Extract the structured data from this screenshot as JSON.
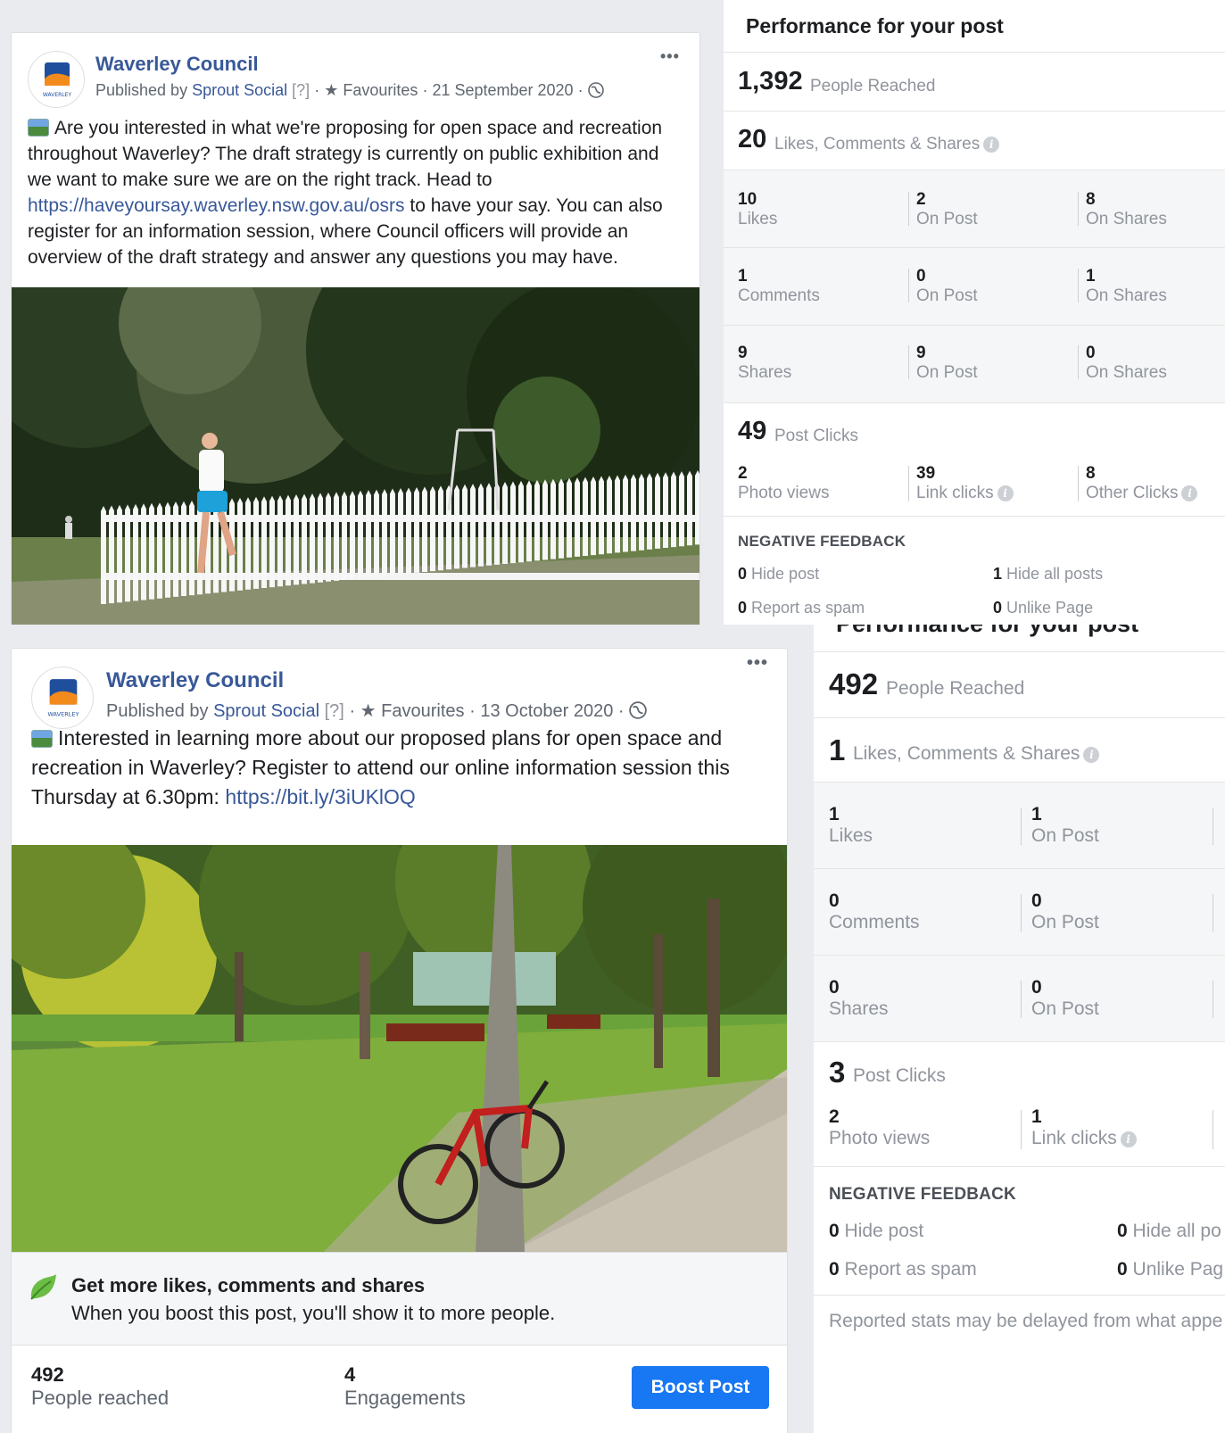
{
  "post1": {
    "page_name": "Waverley Council",
    "published_by_prefix": "Published by",
    "publisher": "Sprout Social",
    "help_marker": "[?]",
    "separator": "·",
    "favourites": "Favourites",
    "date": "21 September 2020",
    "more": "•••",
    "avatar_text": "WAVERLEY",
    "text_before_link": "Are you interested in what we're proposing for open space and recreation throughout Waverley? The draft strategy is currently on public exhibition and we want to make sure we are on the right track. Head to",
    "link": "https://haveyoursay.waverley.nsw.gov.au/osrs",
    "text_after_link": "to have your say. You can also register for an information session, where Council officers will provide an overview of the draft strategy and answer any questions you may have."
  },
  "perf1": {
    "title": "Performance for your post",
    "reached_num": "1,392",
    "reached_label": "People Reached",
    "engage_num": "20",
    "engage_label": "Likes, Comments & Shares",
    "rows": [
      {
        "a_num": "10",
        "a_lbl": "Likes",
        "b_num": "2",
        "b_lbl": "On Post",
        "c_num": "8",
        "c_lbl": "On Shares"
      },
      {
        "a_num": "1",
        "a_lbl": "Comments",
        "b_num": "0",
        "b_lbl": "On Post",
        "c_num": "1",
        "c_lbl": "On Shares"
      },
      {
        "a_num": "9",
        "a_lbl": "Shares",
        "b_num": "9",
        "b_lbl": "On Post",
        "c_num": "0",
        "c_lbl": "On Shares"
      }
    ],
    "clicks_num": "49",
    "clicks_label": "Post Clicks",
    "clicks": {
      "a_num": "2",
      "a_lbl": "Photo views",
      "b_num": "39",
      "b_lbl": "Link clicks",
      "c_num": "8",
      "c_lbl": "Other Clicks"
    },
    "neg_title": "NEGATIVE FEEDBACK",
    "neg": {
      "hide_post_num": "0",
      "hide_post_lbl": "Hide post",
      "hide_all_num": "1",
      "hide_all_lbl": "Hide all posts",
      "spam_num": "0",
      "spam_lbl": "Report as spam",
      "unlike_num": "0",
      "unlike_lbl": "Unlike Page"
    }
  },
  "post2": {
    "page_name": "Waverley Council",
    "published_by_prefix": "Published by",
    "publisher": "Sprout Social",
    "help_marker": "[?]",
    "separator": "·",
    "favourites": "Favourites",
    "date": "13 October 2020",
    "more": "•••",
    "avatar_text": "WAVERLEY",
    "text_before_link": "Interested in learning more about our proposed plans for open space and recreation in Waverley? Register to attend our online information session this Thursday at 6.30pm:",
    "link": "https://bit.ly/3iUKlOQ",
    "boost_title": "Get more likes, comments and shares",
    "boost_sub": "When you boost this post, you'll show it to more people.",
    "reached_num": "492",
    "reached_lbl": "People reached",
    "engage_num": "4",
    "engage_lbl": "Engagements",
    "boost_button": "Boost Post"
  },
  "perf2": {
    "title": "Performance for your post",
    "reached_num": "492",
    "reached_label": "People Reached",
    "engage_num": "1",
    "engage_label": "Likes, Comments & Shares",
    "rows": [
      {
        "a_num": "1",
        "a_lbl": "Likes",
        "b_num": "1",
        "b_lbl": "On Post"
      },
      {
        "a_num": "0",
        "a_lbl": "Comments",
        "b_num": "0",
        "b_lbl": "On Post"
      },
      {
        "a_num": "0",
        "a_lbl": "Shares",
        "b_num": "0",
        "b_lbl": "On Post"
      }
    ],
    "clicks_num": "3",
    "clicks_label": "Post Clicks",
    "clicks": {
      "a_num": "2",
      "a_lbl": "Photo views",
      "b_num": "1",
      "b_lbl": "Link clicks"
    },
    "neg_title": "NEGATIVE FEEDBACK",
    "neg": {
      "hide_post_num": "0",
      "hide_post_lbl": "Hide post",
      "hide_all_num": "0",
      "hide_all_lbl": "Hide all po",
      "spam_num": "0",
      "spam_lbl": "Report as spam",
      "unlike_num": "0",
      "unlike_lbl": "Unlike Pag"
    },
    "footer": "Reported stats may be delayed from what appe"
  },
  "colors": {
    "link": "#385898",
    "muted": "#90949c",
    "button": "#1877f2",
    "panel_bg": "#e9ebee"
  }
}
